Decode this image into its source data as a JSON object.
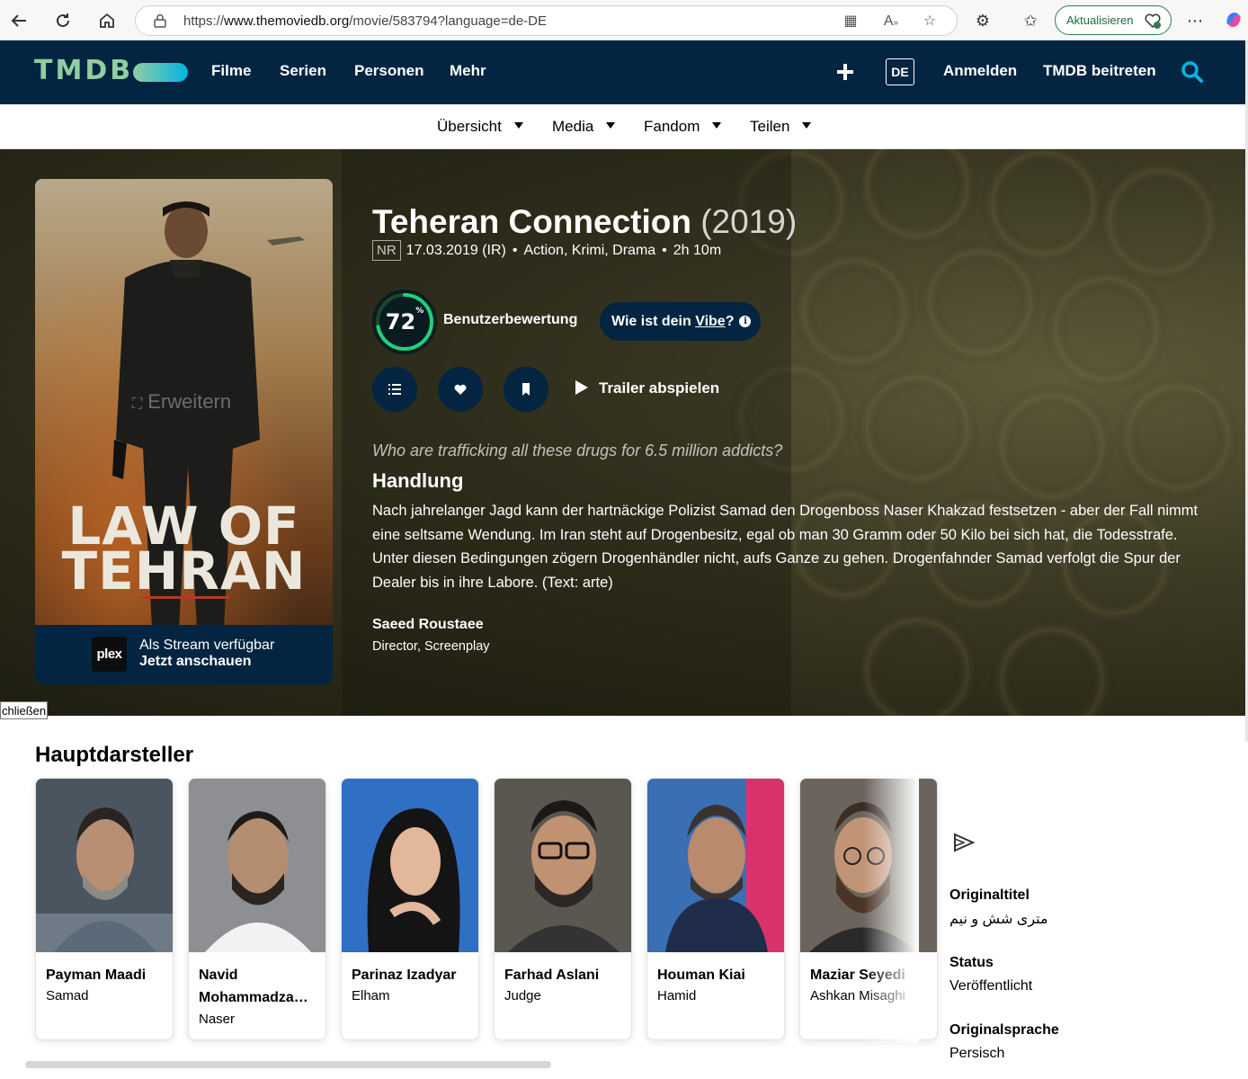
{
  "browser": {
    "url_prefix": "https://",
    "url_host": "www.themoviedb.org",
    "url_path": "/movie/583794?language=de-DE",
    "update_label": "Aktualisieren"
  },
  "header": {
    "logo": "TMDB",
    "nav": [
      "Filme",
      "Serien",
      "Personen",
      "Mehr"
    ],
    "language": "DE",
    "login": "Anmelden",
    "join": "TMDB beitreten"
  },
  "subnav": [
    "Übersicht",
    "Media",
    "Fandom",
    "Teilen"
  ],
  "poster": {
    "title_line1": "LAW OF",
    "title_line2": "TEHRAN",
    "expand_label": "Erweitern",
    "stream_logo": "plex",
    "stream_line1": "Als Stream verfügbar",
    "stream_line2": "Jetzt anschauen"
  },
  "movie": {
    "title": "Teheran Connection",
    "year": "(2019)",
    "certification": "NR",
    "release": "17.03.2019 (IR)",
    "genres": "Action, Krimi, Drama",
    "runtime": "2h 10m",
    "score": "72",
    "score_pct": 72,
    "score_unit": "%",
    "score_label": "Benutzerbewertung",
    "vibe_prefix": "Wie ist dein ",
    "vibe_link": "Vibe",
    "vibe_suffix": "?",
    "trailer_label": "Trailer abspielen",
    "tagline": "Who are trafficking all these drugs for 6.5 million addicts?",
    "overview_heading": "Handlung",
    "overview": "Nach jahrelanger Jagd kann der hartnäckige Polizist Samad den Drogenboss Naser Khakzad festsetzen - aber der Fall nimmt eine seltsame Wendung. Im Iran steht auf Drogenbesitz, egal ob man 30 Gramm oder 50 Kilo bei sich hat, die Todesstrafe. Unter diesen Bedingungen zögern Drogenhändler nicht, aufs Ganze zu gehen. Drogenfahnder Samad verfolgt die Spur der Dealer bis in ihre Labore. (Text: arte)",
    "crew_name": "Saeed Roustaee",
    "crew_role": "Director, Screenplay"
  },
  "close_label": "chließen",
  "cast": {
    "heading": "Hauptdarsteller",
    "members": [
      {
        "name": "Payman Maadi",
        "character": "Samad"
      },
      {
        "name": "Navid Mohammadza…",
        "character": "Naser"
      },
      {
        "name": "Parinaz Izadyar",
        "character": "Elham"
      },
      {
        "name": "Farhad Aslani",
        "character": "Judge"
      },
      {
        "name": "Houman Kiai",
        "character": "Hamid"
      },
      {
        "name": "Maziar Seyedi",
        "character": "Ashkan Misaghi"
      }
    ]
  },
  "facts": {
    "original_title_label": "Originaltitel",
    "original_title": "متری شش و نیم",
    "status_label": "Status",
    "status": "Veröffentlicht",
    "language_label": "Originalsprache",
    "language": "Persisch"
  },
  "colors": {
    "brand_dark": "#032541",
    "brand_green": "#90cea1",
    "brand_blue": "#01b4e4",
    "score_green": "#21d07a"
  }
}
